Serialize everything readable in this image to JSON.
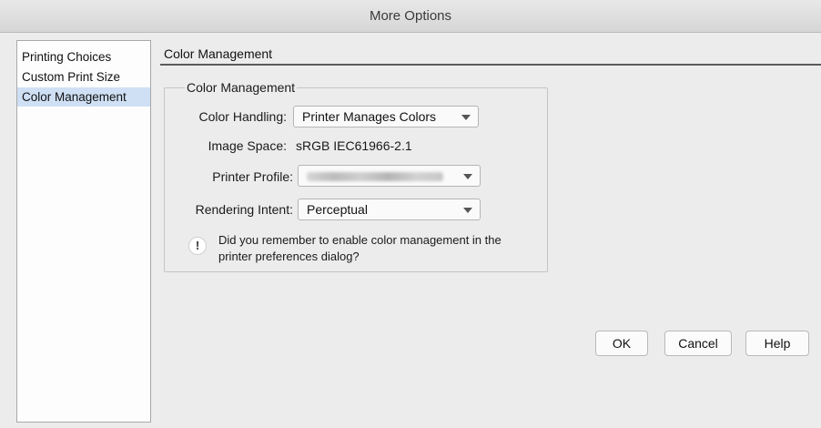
{
  "window": {
    "title": "More Options"
  },
  "sidebar": {
    "items": [
      {
        "label": "Printing Choices",
        "selected": false
      },
      {
        "label": "Custom Print Size",
        "selected": false
      },
      {
        "label": "Color Management",
        "selected": true
      }
    ]
  },
  "section": {
    "title": "Color Management"
  },
  "group": {
    "legend": "Color Management",
    "color_handling": {
      "label": "Color Handling:",
      "value": "Printer Manages Colors"
    },
    "image_space": {
      "label": "Image Space:",
      "value": "sRGB IEC61966-2.1"
    },
    "printer_profile": {
      "label": "Printer Profile:"
    },
    "rendering_intent": {
      "label": "Rendering Intent:",
      "value": "Perceptual"
    },
    "note": "Did you remember to enable color management in the printer preferences dialog?"
  },
  "buttons": {
    "ok": "OK",
    "cancel": "Cancel",
    "help": "Help"
  },
  "colors": {
    "selection": "#cfe0f5",
    "background": "#ececec"
  }
}
